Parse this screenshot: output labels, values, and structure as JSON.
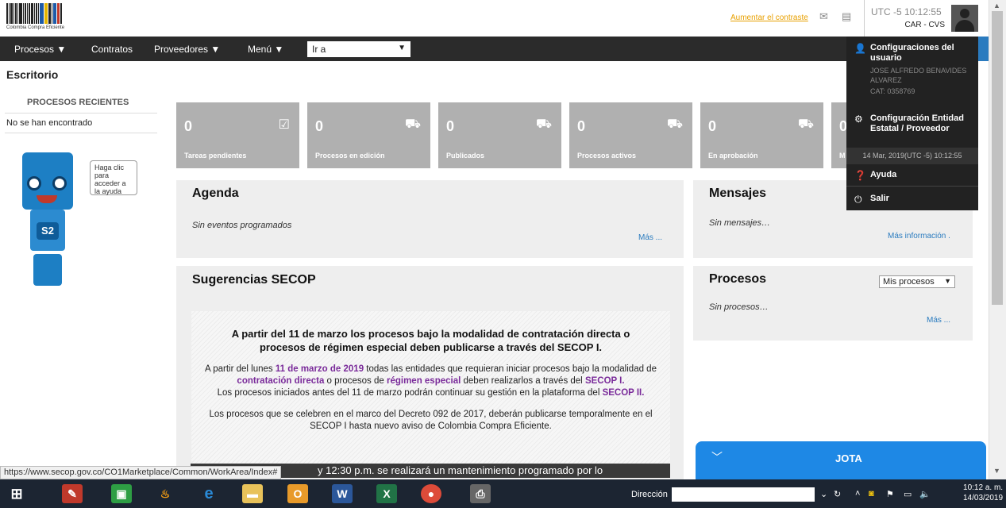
{
  "header": {
    "logo_caption": "Colombia Compra Eficiente",
    "contrast_link": "Aumentar el contraste",
    "clock": "UTC -5 10:12:55",
    "user_org": "CAR - CVS"
  },
  "nav": {
    "items": [
      {
        "label": "Procesos ▼"
      },
      {
        "label": "Contratos"
      },
      {
        "label": "Proveedores ▼"
      },
      {
        "label": "Menú ▼"
      }
    ],
    "goto_value": "Ir a"
  },
  "page_title": "Escritorio",
  "recent": {
    "heading": "PROCESOS RECIENTES",
    "empty": "No se han encontrado"
  },
  "help_bubble": "Haga clic para acceder a la ayuda",
  "robot_label": "S2",
  "tiles": [
    {
      "count": "0",
      "label": "Tareas pendientes",
      "icon": "clipboard-check-icon"
    },
    {
      "count": "0",
      "label": "Procesos en edición",
      "icon": "cart-icon"
    },
    {
      "count": "0",
      "label": "Publicados",
      "icon": "cart-icon"
    },
    {
      "count": "0",
      "label": "Procesos activos",
      "icon": "cart-icon"
    },
    {
      "count": "0",
      "label": "En aprobación",
      "icon": "cart-icon"
    },
    {
      "count": "0",
      "label": "M",
      "icon": "cart-icon"
    }
  ],
  "agenda": {
    "title": "Agenda",
    "empty": "Sin eventos programados",
    "more": "Más ..."
  },
  "mensajes": {
    "title": "Mensajes",
    "empty": "Sin mensajes…",
    "more": "Más información ."
  },
  "procesos": {
    "title": "Procesos",
    "select": "Mis procesos",
    "empty": "Sin procesos…",
    "more": "Más ..."
  },
  "sugerencias": {
    "title": "Sugerencias SECOP"
  },
  "banner": {
    "title": "A partir del 11 de marzo los procesos bajo la modalidad de contratación directa o procesos de régimen especial deben publicarse a través del SECOP I.",
    "p1_a": "A partir del lunes ",
    "p1_date": "11 de marzo de 2019",
    "p1_b": " todas las entidades que requieran iniciar procesos bajo la modalidad de ",
    "p1_cd": "contratación directa",
    "p1_c": " o procesos de ",
    "p1_re": "régimen especial",
    "p1_d": " deben realizarlos a través del ",
    "p1_s1": "SECOP I.",
    "p2_a": "Los procesos iniciados antes del 11 de marzo podrán continuar su gestión en la plataforma del ",
    "p2_s2": "SECOP II.",
    "p3": "Los procesos que se celebren en el marco del Decreto 092 de 2017, deberán publicarse temporalmente en el SECOP I hasta nuevo aviso de Colombia Compra Eficiente.",
    "maint": "y 12:30 p.m. se realizará un mantenimiento programado por lo"
  },
  "user_menu": {
    "config_user": "Configuraciones del usuario",
    "user_name": "JOSE ALFREDO BENAVIDES ALVAREZ",
    "user_cat": "CAT: 0358769",
    "config_entity": "Configuración Entidad Estatal / Proveedor",
    "timestamp": "14 Mar, 2019(UTC -5) 10:12:55",
    "help": "Ayuda",
    "logout": "Salir"
  },
  "chat": {
    "title": "JOTA"
  },
  "status_url": "https://www.secop.gov.co/CO1Marketplace/Common/WorkArea/Index#",
  "taskbar": {
    "address_label": "Dirección",
    "time": "10:12 a. m.",
    "date": "14/03/2019"
  },
  "colors": {
    "nav_bg": "#2b2b2b",
    "tile_bg": "#b0b0b0",
    "accent_link": "#2a7bbf",
    "contrast_link": "#e8a000",
    "highlight_purple": "#7a2b9a",
    "chat_blue": "#1e88e5"
  }
}
